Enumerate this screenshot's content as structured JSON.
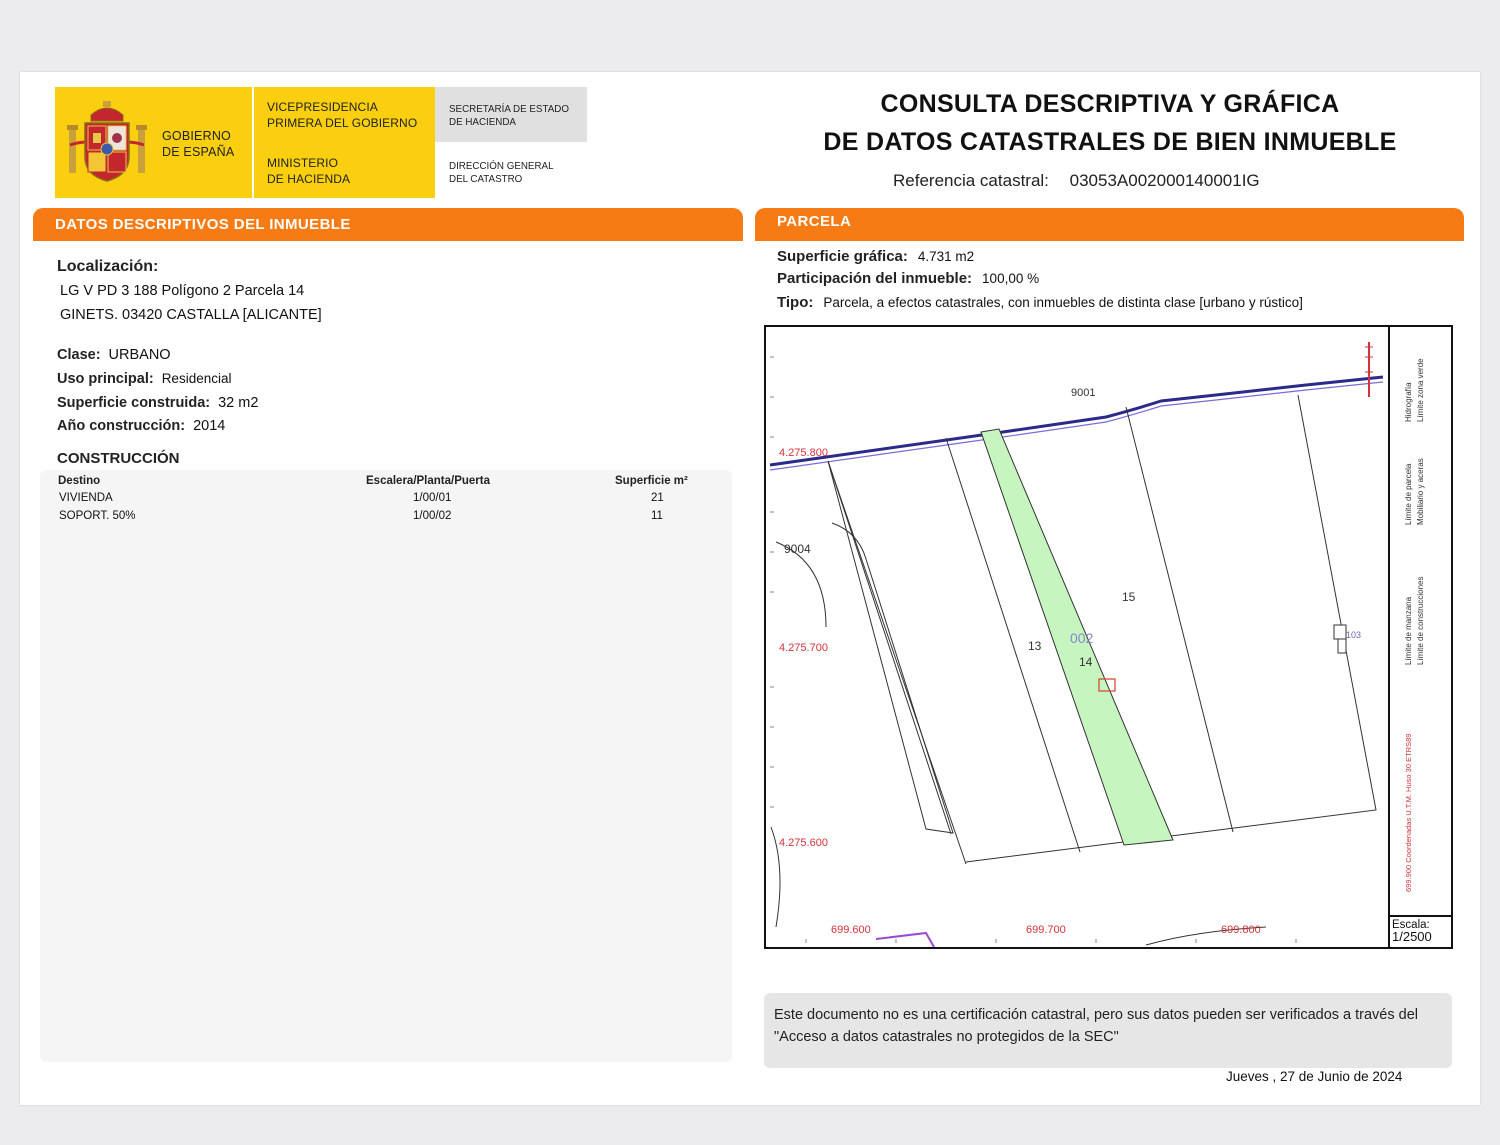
{
  "header": {
    "gobierno": [
      "GOBIERNO",
      "DE ESPAÑA"
    ],
    "vicepresidencia": [
      "VICEPRESIDENCIA",
      "PRIMERA DEL GOBIERNO"
    ],
    "ministerio": [
      "MINISTERIO",
      "DE HACIENDA"
    ],
    "secretaria": [
      "SECRETARÍA DE ESTADO",
      "DE HACIENDA"
    ],
    "direccion": [
      "DIRECCIÓN GENERAL",
      "DEL CATASTRO"
    ],
    "title_line1": "CONSULTA DESCRIPTIVA Y GRÁFICA",
    "title_line2": "DE DATOS CATASTRALES DE BIEN INMUEBLE",
    "ref_label": "Referencia catastral:",
    "ref_value": "03053A002000140001IG"
  },
  "left": {
    "section_title": "DATOS DESCRIPTIVOS DEL INMUEBLE",
    "loc_label": "Localización:",
    "loc_line1": "LG V PD 3 188 Polígono 2 Parcela 14",
    "loc_line2": "GINETS. 03420 CASTALLA [ALICANTE]",
    "clase_label": "Clase:",
    "clase_value": "URBANO",
    "uso_label": "Uso principal:",
    "uso_value": "Residencial",
    "sup_label": "Superficie construida:",
    "sup_value": "32 m2",
    "ano_label": "Año construcción:",
    "ano_value": "2014",
    "construccion_title": "CONSTRUCCIÓN",
    "table": {
      "headers": [
        "Destino",
        "Escalera/Planta/Puerta",
        "Superficie m²"
      ],
      "rows": [
        [
          "VIVIENDA",
          "1/00/01",
          "21"
        ],
        [
          "SOPORT. 50%",
          "1/00/02",
          "11"
        ]
      ]
    }
  },
  "right": {
    "section_title": "PARCELA",
    "sup_label": "Superficie gráfica:",
    "sup_value": "4.731 m2",
    "part_label": "Participación del inmueble:",
    "part_value": "100,00 %",
    "tipo_label": "Tipo:",
    "tipo_value": "Parcela, a efectos catastrales, con inmuebles de distinta clase [urbano y rústico]",
    "map": {
      "parcel_labels": [
        "13",
        "14",
        "15",
        "002",
        "9004",
        "9001",
        "103"
      ],
      "coords_y": [
        "4.275.800",
        "4.275.700",
        "4.275.600"
      ],
      "coords_x": [
        "699.600",
        "699.700",
        "699.800"
      ],
      "legend": [
        "Límite de manzana",
        "Límite de parcela",
        "Límite de construcciones",
        "Mobiliario y aceras",
        "Límite zona verde",
        "Hidrografía"
      ],
      "legend_coords": "699.900 Coordenadas U.T.M. Huso 30 ETRS89",
      "escala_label": "Escala:",
      "escala_value": "1/2500",
      "highlight_color": "#c6f5c0"
    },
    "note": "Este documento no es una certificación catastral, pero sus datos pueden ser verificados a través del \"Acceso a datos catastrales no protegidos de la SEC\"",
    "date": "Jueves , 27 de Junio de 2024"
  }
}
